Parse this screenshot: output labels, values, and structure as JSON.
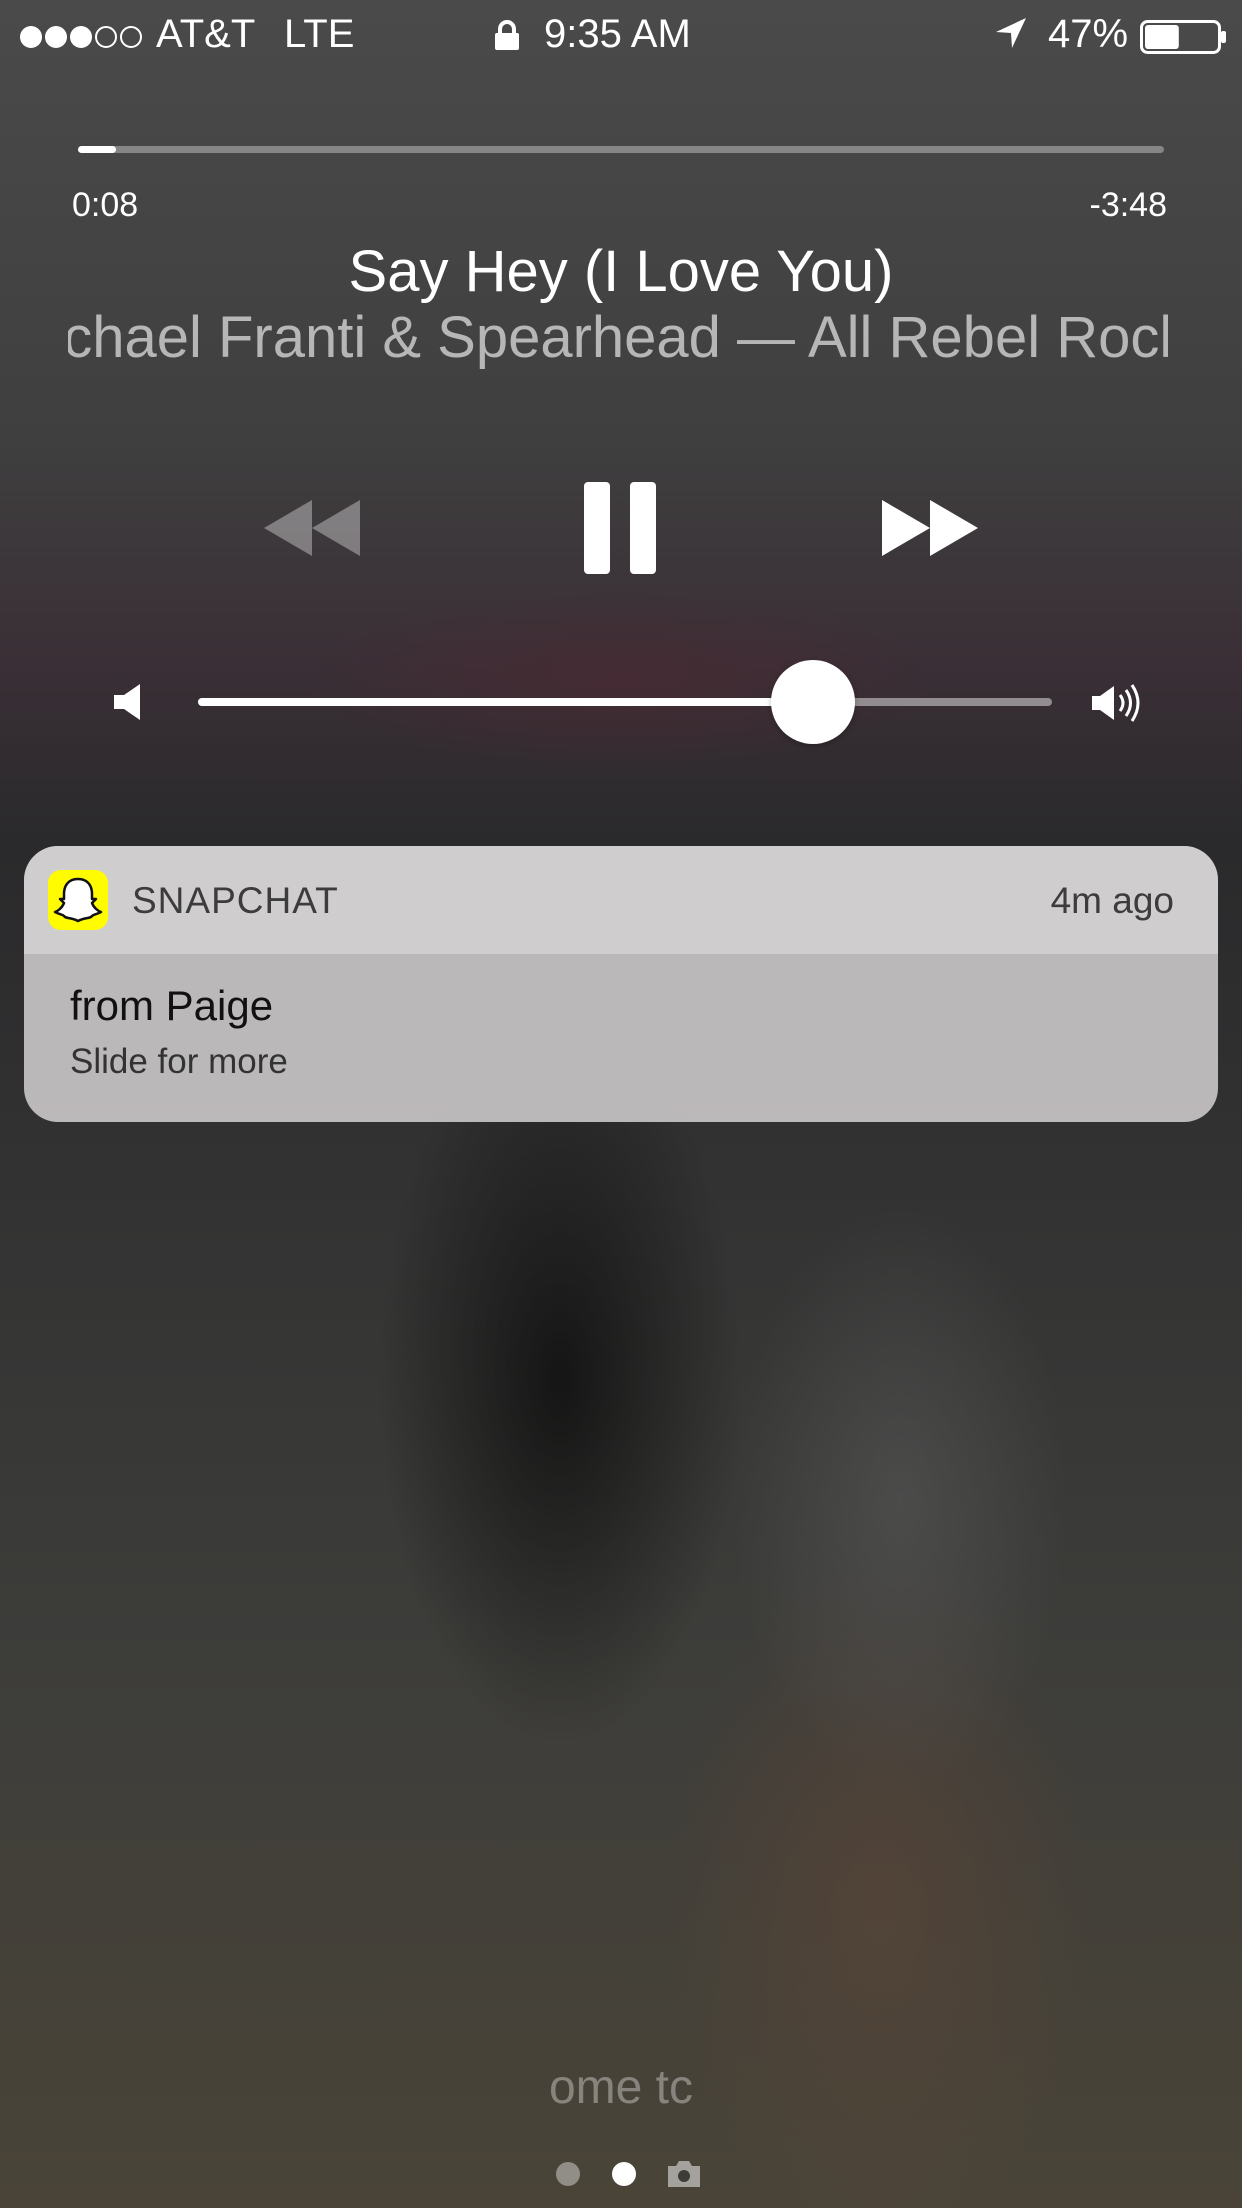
{
  "status_bar": {
    "carrier": "AT&T",
    "network": "LTE",
    "time": "9:35 AM",
    "battery": "47%",
    "signal_bars": 3,
    "signal_max": 5,
    "battery_level": 0.47
  },
  "now_playing": {
    "elapsed": "0:08",
    "remaining": "-3:48",
    "progress": 0.035,
    "title": "Say Hey (I Love You)",
    "subtitle": "Michael Franti & Spearhead — All Rebel Rockers      M",
    "volume": 0.72
  },
  "icons": {
    "prev": "rewind-icon",
    "play_pause": "pause-icon",
    "next": "fast-forward-icon",
    "volume_low": "speaker-low-icon",
    "volume_high": "speaker-high-icon",
    "lock": "lock-icon",
    "location": "location-arrow-icon",
    "camera": "camera-icon",
    "app": "snapchat-ghost-icon"
  },
  "notification": {
    "app": "SNAPCHAT",
    "time": "4m ago",
    "title": "from Paige",
    "body": "Slide for more",
    "app_color": "#fffc00"
  },
  "lock_screen": {
    "unlock_hint": "ome tc",
    "pages": 3,
    "current_page": 1
  }
}
